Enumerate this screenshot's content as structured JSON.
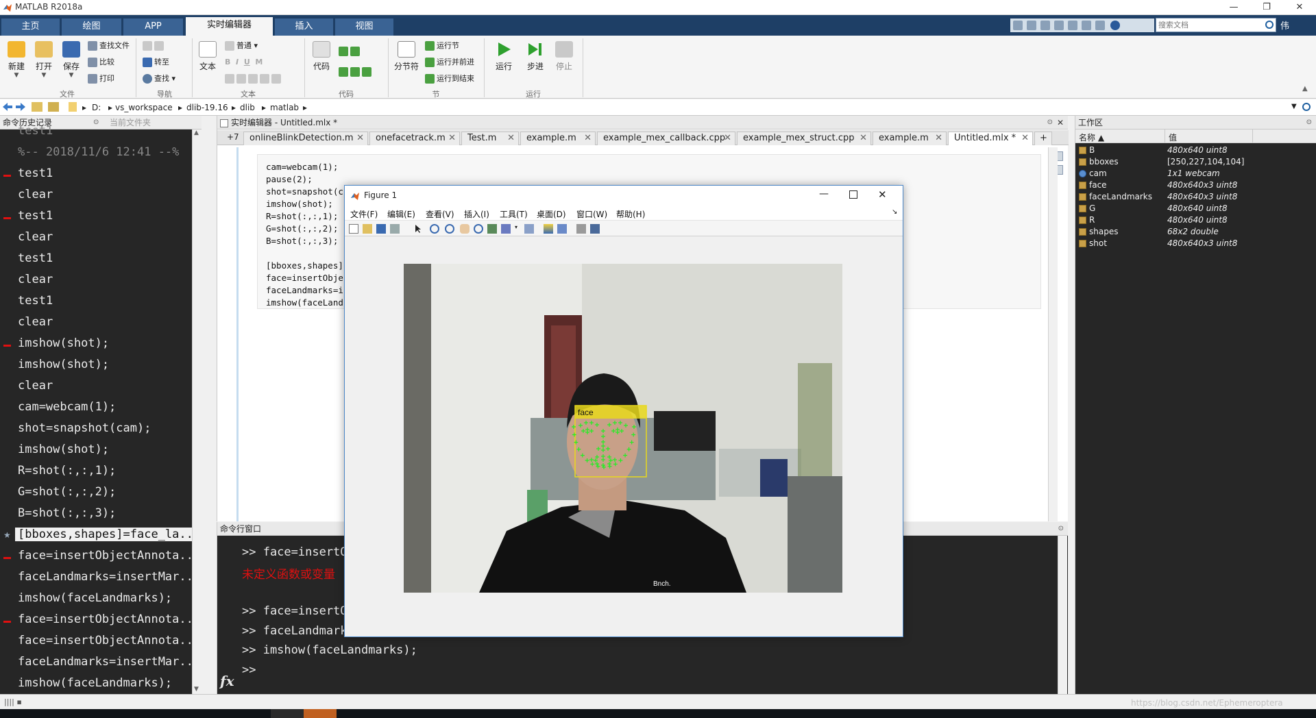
{
  "app": {
    "title": "MATLAB R2018a",
    "window_controls": [
      "—",
      "❐",
      "✕"
    ]
  },
  "ribbon": {
    "tabs": [
      "主页",
      "绘图",
      "APP",
      "实时编辑器",
      "插入",
      "视图"
    ],
    "active_tab": "实时编辑器",
    "search_placeholder": "搜索文档",
    "user": "伟",
    "groups": {
      "file": {
        "label": "文件",
        "new": "新建",
        "open": "打开",
        "save": "保存",
        "find_file": "查找文件",
        "compare": "比较",
        "print": "打印"
      },
      "navigate": {
        "label": "导航",
        "goto": "转至",
        "find": "查找"
      },
      "text": {
        "label": "文本",
        "text_btn": "文本",
        "style": "普通"
      },
      "code": {
        "label": "代码",
        "code_btn": "代码"
      },
      "section": {
        "label": "节",
        "section_break": "分节符",
        "run_section": "运行节",
        "run_advance": "运行并前进",
        "run_to_end": "运行到结束"
      },
      "run": {
        "label": "运行",
        "run": "运行",
        "step": "步进",
        "stop": "停止"
      }
    }
  },
  "address": {
    "path": [
      "D:",
      "vs_workspace",
      "dlib-19.16",
      "dlib",
      "matlab"
    ]
  },
  "history": {
    "title": "命令历史记录",
    "tab2": "当前文件夹",
    "lines": [
      {
        "text": "test1",
        "dim": true,
        "mark": false
      },
      {
        "text": "%-- 2018/11/6 12:41 --%",
        "dim": true,
        "mark": false
      },
      {
        "text": "test1",
        "dim": false,
        "mark": true
      },
      {
        "text": "clear",
        "dim": false,
        "mark": false
      },
      {
        "text": "test1",
        "dim": false,
        "mark": true
      },
      {
        "text": "clear",
        "dim": false,
        "mark": false
      },
      {
        "text": "test1",
        "dim": false,
        "mark": false
      },
      {
        "text": "clear",
        "dim": false,
        "mark": false
      },
      {
        "text": "test1",
        "dim": false,
        "mark": false
      },
      {
        "text": "clear",
        "dim": false,
        "mark": false
      },
      {
        "text": "imshow(shot);",
        "dim": false,
        "mark": true
      },
      {
        "text": "imshow(shot);",
        "dim": false,
        "mark": false
      },
      {
        "text": "clear",
        "dim": false,
        "mark": false
      },
      {
        "text": "cam=webcam(1);",
        "dim": false,
        "mark": false
      },
      {
        "text": "shot=snapshot(cam);",
        "dim": false,
        "mark": false
      },
      {
        "text": "imshow(shot);",
        "dim": false,
        "mark": false
      },
      {
        "text": "R=shot(:,:,1);",
        "dim": false,
        "mark": false
      },
      {
        "text": "G=shot(:,:,2);",
        "dim": false,
        "mark": false
      },
      {
        "text": "B=shot(:,:,3);",
        "dim": false,
        "mark": false
      },
      {
        "text": "[bboxes,shapes]=face_la...",
        "dim": false,
        "mark": false,
        "selected": true
      },
      {
        "text": "face=insertObjectAnnota...",
        "dim": false,
        "mark": true
      },
      {
        "text": "faceLandmarks=insertMar...",
        "dim": false,
        "mark": false
      },
      {
        "text": "imshow(faceLandmarks);",
        "dim": false,
        "mark": false
      },
      {
        "text": "face=insertObjectAnnota...",
        "dim": false,
        "mark": true
      },
      {
        "text": "face=insertObjectAnnota...",
        "dim": false,
        "mark": false
      },
      {
        "text": "faceLandmarks=insertMar...",
        "dim": false,
        "mark": false
      },
      {
        "text": "imshow(faceLandmarks);",
        "dim": false,
        "mark": false
      }
    ]
  },
  "editor": {
    "title": "实时编辑器 - Untitled.mlx *",
    "overflow": "+7",
    "tabs": [
      {
        "label": "onlineBlinkDetection.m",
        "active": false
      },
      {
        "label": "onefacetrack.m",
        "active": false
      },
      {
        "label": "Test.m",
        "active": false
      },
      {
        "label": "example.m",
        "active": false
      },
      {
        "label": "example_mex_callback.cpp",
        "active": false
      },
      {
        "label": "example_mex_struct.cpp",
        "active": false
      },
      {
        "label": "example.m",
        "active": false
      },
      {
        "label": "Untitled.mlx *",
        "active": true
      }
    ],
    "add_tab": "+",
    "code": [
      "cam=webcam(1);",
      "pause(2);",
      "shot=snapshot(c",
      "imshow(shot);",
      "R=shot(:,:,1);",
      "G=shot(:,:,2);",
      "B=shot(:,:,3);",
      "",
      "[bboxes,shapes]",
      "face=insertObje",
      "faceLandmarks=i",
      "imshow(faceLand"
    ]
  },
  "command_window": {
    "title": "命令行窗口",
    "fx": "fx",
    "lines": [
      {
        "text": ">> face=insertO",
        "error": false
      },
      {
        "text": "未定义函数或变量",
        "error": true
      },
      {
        "text": "",
        "error": false
      },
      {
        "text": ">> face=insertO",
        "error": false
      },
      {
        "text": ">> faceLandmarks=insertMarker(face,shapes);",
        "error": false
      },
      {
        "text": ">> imshow(faceLandmarks);",
        "error": false
      },
      {
        "text": ">>",
        "error": false
      }
    ]
  },
  "workspace": {
    "title": "工作区",
    "col_name": "名称 ▲",
    "col_value": "值",
    "vars": [
      {
        "name": "B",
        "value": "480x640 uint8",
        "italic": true,
        "object": false
      },
      {
        "name": "bboxes",
        "value": "[250,227,104,104]",
        "italic": false,
        "object": false
      },
      {
        "name": "cam",
        "value": "1x1 webcam",
        "italic": true,
        "object": true
      },
      {
        "name": "face",
        "value": "480x640x3 uint8",
        "italic": true,
        "object": false
      },
      {
        "name": "faceLandmarks",
        "value": "480x640x3 uint8",
        "italic": true,
        "object": false
      },
      {
        "name": "G",
        "value": "480x640 uint8",
        "italic": true,
        "object": false
      },
      {
        "name": "R",
        "value": "480x640 uint8",
        "italic": true,
        "object": false
      },
      {
        "name": "shapes",
        "value": "68x2 double",
        "italic": true,
        "object": false
      },
      {
        "name": "shot",
        "value": "480x640x3 uint8",
        "italic": true,
        "object": false
      }
    ]
  },
  "figure": {
    "title": "Figure 1",
    "menu": [
      "文件(F)",
      "编辑(E)",
      "查看(V)",
      "插入(I)",
      "工具(T)",
      "桌面(D)",
      "窗口(W)",
      "帮助(H)"
    ],
    "annotation_label": "face",
    "shirt_text": "Bnch."
  },
  "statusbar": {
    "watermark": "https://blog.csdn.net/Ephemeroptera"
  },
  "colors": {
    "ribbon_dark": "#1e3f66",
    "ribbon_tab": "#3a6394",
    "console_bg": "#262626",
    "error_red": "#e01010",
    "annotation_yellow": "#e8d81c",
    "landmark_green": "#22ee22"
  }
}
